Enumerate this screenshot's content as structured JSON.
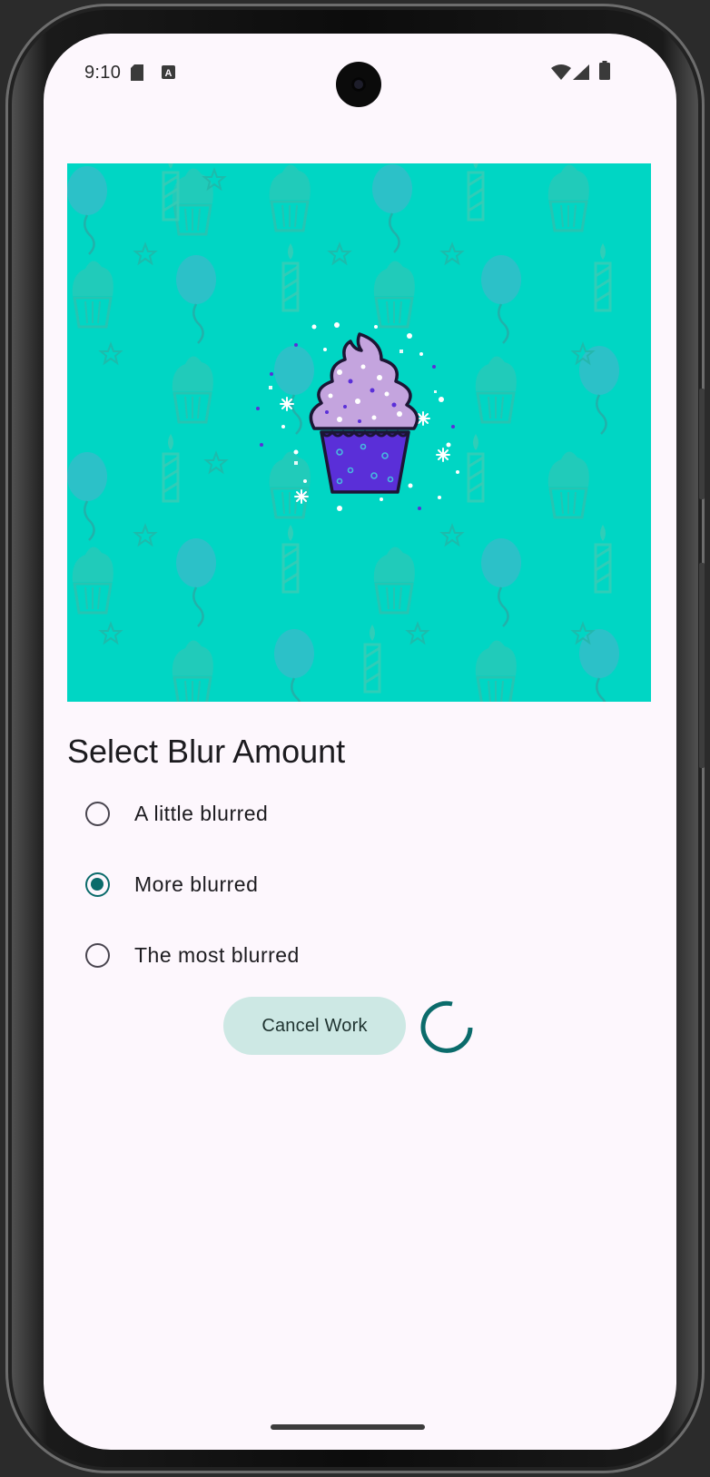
{
  "status_bar": {
    "time": "9:10",
    "left_icons": [
      "sd-card-icon",
      "keyboard-a-icon"
    ],
    "right_icons": [
      "wifi-icon",
      "cell-signal-icon",
      "battery-icon"
    ]
  },
  "hero": {
    "image_name": "cupcake-image",
    "background_color": "#00d6c4"
  },
  "blur_section": {
    "title": "Select Blur Amount",
    "options": [
      {
        "label": "A little blurred",
        "checked": false
      },
      {
        "label": "More blurred",
        "checked": true
      },
      {
        "label": "The most blurred",
        "checked": false
      }
    ]
  },
  "actions": {
    "cancel_label": "Cancel Work",
    "progress": "indeterminate"
  },
  "colors": {
    "screen_bg": "#fdf7fd",
    "accent": "#0b6b6b",
    "button_bg": "#cde8e4",
    "cupcake_frosting": "#c4a4de",
    "cupcake_wrapper": "#5a2fd8"
  }
}
